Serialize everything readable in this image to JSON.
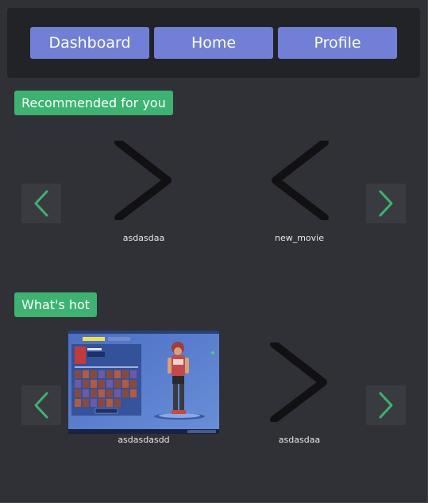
{
  "nav": {
    "buttons": [
      {
        "label": "Dashboard"
      },
      {
        "label": "Home"
      },
      {
        "label": "Profile"
      }
    ]
  },
  "sections": [
    {
      "title": "Recommended for you",
      "items": [
        {
          "label": "asdasdaa",
          "thumbnail": "chevron-right-icon"
        },
        {
          "label": "new_movie",
          "thumbnail": "chevron-left-icon"
        }
      ]
    },
    {
      "title": "What's hot",
      "items": [
        {
          "label": "asdasdasdd",
          "thumbnail": "game-screenshot"
        },
        {
          "label": "asdasdaa",
          "thumbnail": "chevron-right-icon"
        }
      ]
    }
  ],
  "colors": {
    "background": "#303136",
    "navbar": "#222326",
    "nav_button": "#7180d6",
    "accent_green": "#3cb371",
    "arrow_button": "#3a3b41"
  }
}
